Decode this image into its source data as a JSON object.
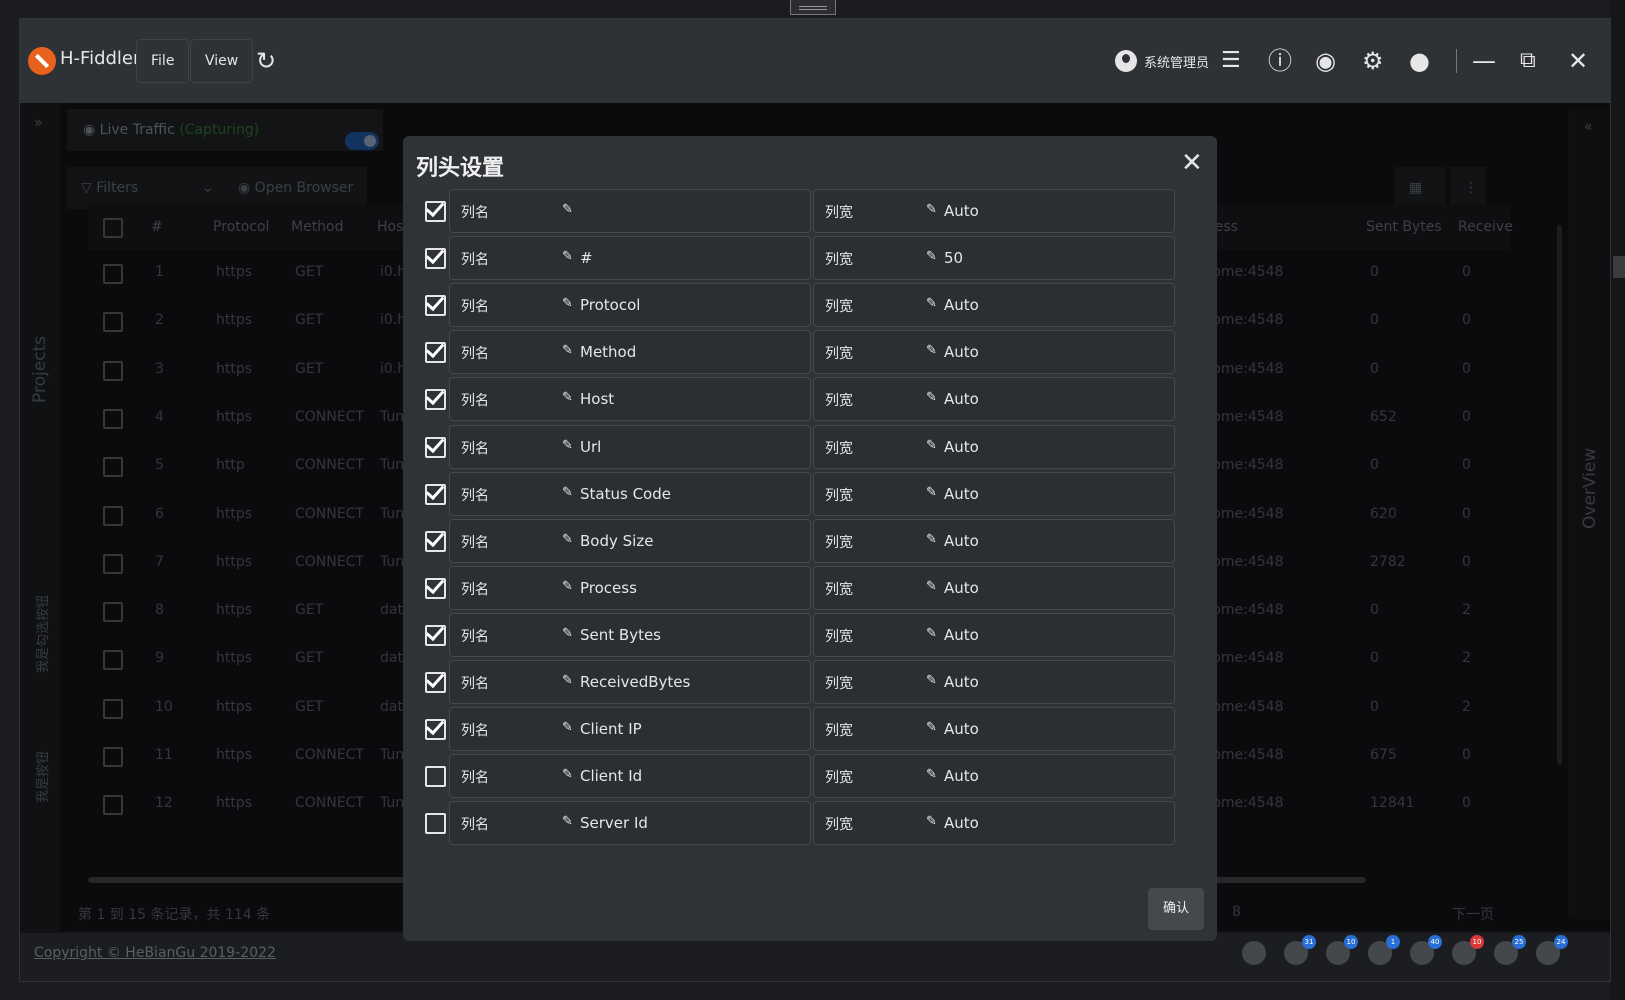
{
  "app": {
    "name": "H-Fiddler",
    "menu": [
      "File",
      "View"
    ],
    "user": "系统管理员"
  },
  "left_rail": {
    "projects": "Projects",
    "btn1": "我是勾选按钮",
    "btn2": "我是按钮"
  },
  "right_rail": {
    "overview": "OverView"
  },
  "live_tab": {
    "label": "Live Traffic",
    "status": "(Capturing)"
  },
  "toolbar": {
    "filters": "Filters",
    "open_browser": "Open Browser"
  },
  "table": {
    "headers": [
      "#",
      "Protocol",
      "Method",
      "Host",
      "rocess",
      "Sent Bytes",
      "Receive"
    ],
    "rows": [
      {
        "n": "1",
        "protocol": "https",
        "method": "GET",
        "host": "i0.hc",
        "process": "hrome:4548",
        "sent": "0",
        "recv": "0"
      },
      {
        "n": "2",
        "protocol": "https",
        "method": "GET",
        "host": "i0.hc",
        "process": "hrome:4548",
        "sent": "0",
        "recv": "0"
      },
      {
        "n": "3",
        "protocol": "https",
        "method": "GET",
        "host": "i0.hc",
        "process": "hrome:4548",
        "sent": "0",
        "recv": "0"
      },
      {
        "n": "4",
        "protocol": "https",
        "method": "CONNECT",
        "host": "Tunn",
        "process": "hrome:4548",
        "sent": "652",
        "recv": "0"
      },
      {
        "n": "5",
        "protocol": "http",
        "method": "CONNECT",
        "host": "Tunn",
        "process": "hrome:4548",
        "sent": "0",
        "recv": "0"
      },
      {
        "n": "6",
        "protocol": "https",
        "method": "CONNECT",
        "host": "Tunn",
        "process": "hrome:4548",
        "sent": "620",
        "recv": "0"
      },
      {
        "n": "7",
        "protocol": "https",
        "method": "CONNECT",
        "host": "Tunn",
        "process": "hrome:4548",
        "sent": "2782",
        "recv": "0"
      },
      {
        "n": "8",
        "protocol": "https",
        "method": "GET",
        "host": "data",
        "process": "hrome:4548",
        "sent": "0",
        "recv": "2"
      },
      {
        "n": "9",
        "protocol": "https",
        "method": "GET",
        "host": "data",
        "process": "hrome:4548",
        "sent": "0",
        "recv": "2"
      },
      {
        "n": "10",
        "protocol": "https",
        "method": "GET",
        "host": "data",
        "process": "hrome:4548",
        "sent": "0",
        "recv": "2"
      },
      {
        "n": "11",
        "protocol": "https",
        "method": "CONNECT",
        "host": "Tunn",
        "process": "hrome:4548",
        "sent": "675",
        "recv": "0"
      },
      {
        "n": "12",
        "protocol": "https",
        "method": "CONNECT",
        "host": "Tunn",
        "process": "hrome:4548",
        "sent": "12841",
        "recv": "0"
      }
    ]
  },
  "pager": {
    "summary": "第 1 到 15 条记录，共 114 条",
    "ellipsis": "...",
    "page": "8",
    "next": "下一页"
  },
  "footer": {
    "copyright": "Copyright © HeBianGu 2019-2022",
    "badges": [
      "31",
      "10",
      "1",
      "40",
      "10",
      "25",
      "24"
    ],
    "badge_colors": [
      "#2a6fd6",
      "#2a6fd6",
      "#2a6fd6",
      "#2a6fd6",
      "#d63a3a",
      "#2a6fd6",
      "#2a6fd6"
    ]
  },
  "modal": {
    "title": "列头设置",
    "name_label": "列名",
    "width_label": "列宽",
    "confirm": "确认",
    "columns": [
      {
        "checked": true,
        "name": "",
        "width": "Auto"
      },
      {
        "checked": true,
        "name": "#",
        "width": "50"
      },
      {
        "checked": true,
        "name": "Protocol",
        "width": "Auto"
      },
      {
        "checked": true,
        "name": "Method",
        "width": "Auto"
      },
      {
        "checked": true,
        "name": "Host",
        "width": "Auto"
      },
      {
        "checked": true,
        "name": "Url",
        "width": "Auto"
      },
      {
        "checked": true,
        "name": "Status Code",
        "width": "Auto"
      },
      {
        "checked": true,
        "name": "Body Size",
        "width": "Auto"
      },
      {
        "checked": true,
        "name": "Process",
        "width": "Auto"
      },
      {
        "checked": true,
        "name": "Sent Bytes",
        "width": "Auto"
      },
      {
        "checked": true,
        "name": "ReceivedBytes",
        "width": "Auto"
      },
      {
        "checked": true,
        "name": "Client IP",
        "width": "Auto"
      },
      {
        "checked": false,
        "name": "Client Id",
        "width": "Auto"
      },
      {
        "checked": false,
        "name": "Server Id",
        "width": "Auto"
      }
    ]
  }
}
